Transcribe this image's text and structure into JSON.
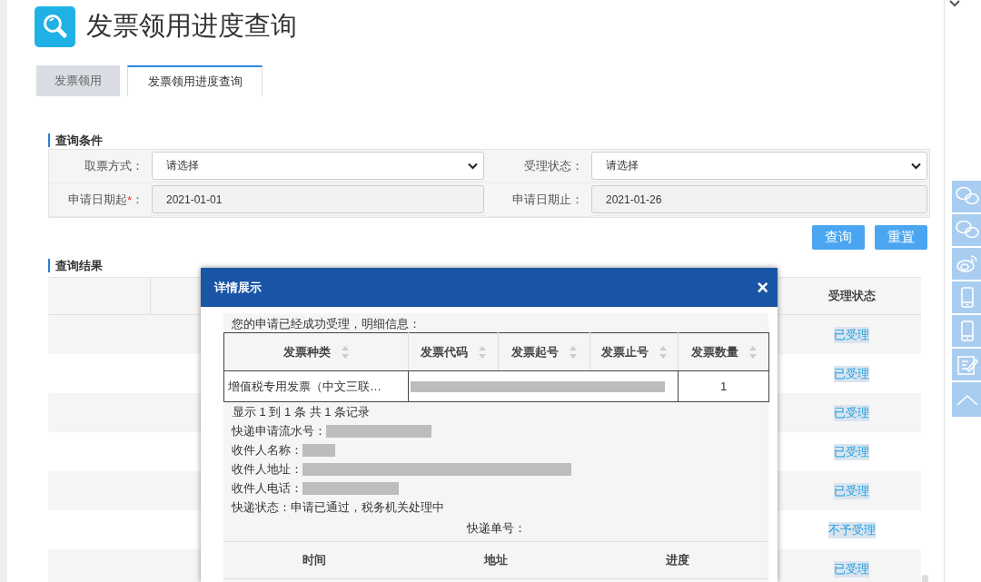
{
  "page_title": "发票领用进度查询",
  "tabs": [
    {
      "label": "发票领用",
      "selected": false
    },
    {
      "label": "发票领用进度查询",
      "selected": true
    }
  ],
  "query_section": {
    "title": "查询条件",
    "fields": [
      {
        "label": "取票方式",
        "colon": "：",
        "kind": "select",
        "value": "请选择"
      },
      {
        "label": "受理状态",
        "colon": "：",
        "kind": "select",
        "value": "请选择"
      },
      {
        "label": "申请日期起",
        "required_mark": "*",
        "colon": "：",
        "kind": "date",
        "value": "2021-01-01"
      },
      {
        "label": "申请日期止",
        "colon": "：",
        "kind": "date",
        "value": "2021-01-26"
      }
    ],
    "buttons": [
      "查询",
      "重置"
    ]
  },
  "results_section": {
    "title": "查询结果",
    "status_column": "受理状态",
    "rows": [
      {
        "status": "已受理"
      },
      {
        "status": "已受理"
      },
      {
        "status": "已受理"
      },
      {
        "status": "已受理"
      },
      {
        "status": "已受理"
      },
      {
        "status": "不予受理"
      },
      {
        "status": "已受理"
      }
    ]
  },
  "dialog": {
    "title": "详情展示",
    "close_label": "×",
    "message": "您的申请已经成功受理，明细信息：",
    "invoice_table": {
      "columns": [
        "发票种类",
        "发票代码",
        "发票起号",
        "发票止号",
        "发票数量"
      ],
      "rows": [
        {
          "type": "增值税专用发票（中文三联…",
          "quantity": "1",
          "redacted": true
        }
      ]
    },
    "pagination": "显示 1 到 1 条 共 1 条记录",
    "details": [
      {
        "label": "快递申请流水号：",
        "redacted": true
      },
      {
        "label": "收件人名称：",
        "redacted": true
      },
      {
        "label": "收件人地址：",
        "redacted": true
      },
      {
        "label": "收件人电话：",
        "redacted": true
      },
      {
        "label": "快递状态：",
        "redacted": false,
        "value": "申请已通过，税务机关处理中"
      }
    ],
    "tracking_label": "快递单号：",
    "tracking_columns": [
      "时间",
      "地址",
      "进度"
    ]
  }
}
